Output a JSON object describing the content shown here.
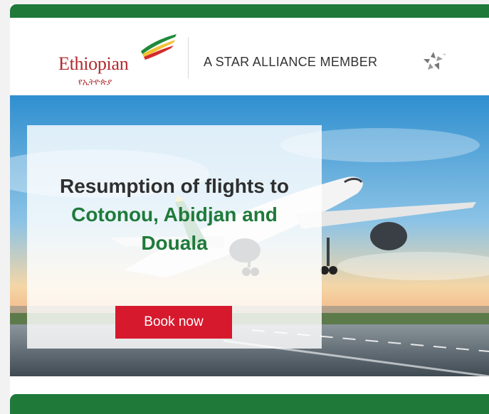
{
  "brand": {
    "name": "Ethiopian",
    "amharic": "የኢትዮጵያ",
    "alliance": "A STAR ALLIANCE MEMBER"
  },
  "hero": {
    "headline_line1": "Resumption of flights to",
    "headline_line2": "Cotonou, Abidjan and",
    "headline_line3": "Douala",
    "cta_label": "Book now"
  },
  "colors": {
    "brand_green": "#1f7a3a",
    "brand_red": "#b1292f",
    "cta_red": "#d7192d"
  },
  "icons": {
    "star_alliance": "star-alliance-icon",
    "logo_wing": "ethiopian-logo-icon"
  }
}
